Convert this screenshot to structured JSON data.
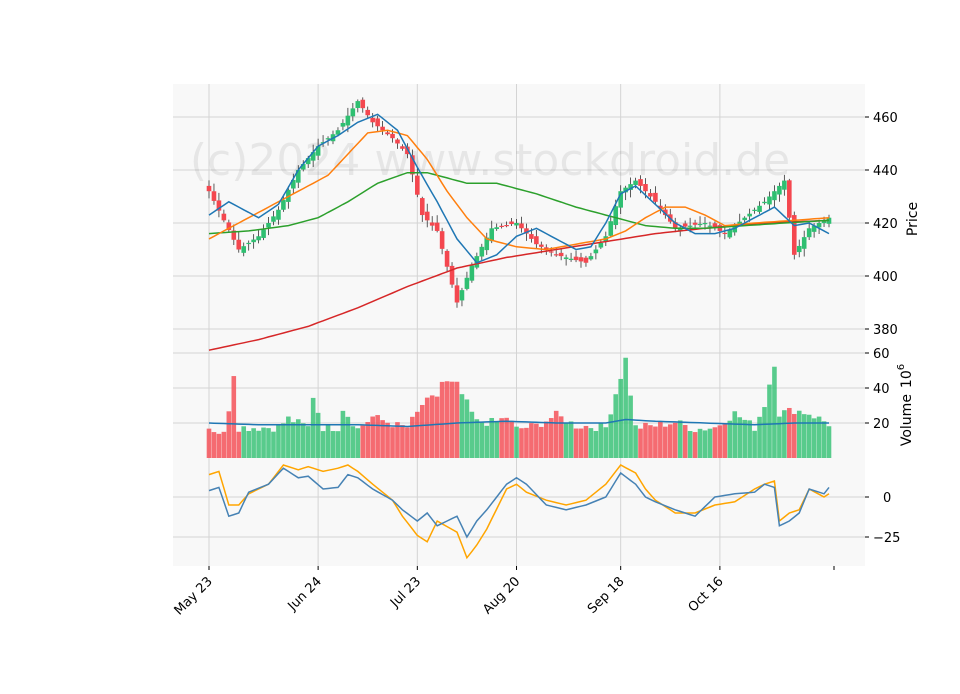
{
  "watermark": "(c)2024 www.stockdroid.de",
  "colors": {
    "up": "#2fbf71",
    "down": "#f4474f",
    "grid": "#d4d4d4",
    "panel": "#f8f8f8",
    "ma_fast": "#1f77b4",
    "ma_mid": "#ff7f0e",
    "ma_slow": "#2ca02c",
    "ma_long": "#d62728",
    "vol_ma": "#1f77b4",
    "osc_a": "#4682b4",
    "osc_b": "#ffa500"
  },
  "chart_data": [
    {
      "type": "candlestick",
      "panel": "price",
      "ylabel": "Price",
      "ylim": [
        375,
        473
      ],
      "yticks": [
        380,
        400,
        420,
        440,
        460
      ],
      "xtick_labels": [
        "May 23",
        "Jun 24",
        "Jul 23",
        "Aug 20",
        "Sep 18",
        "Oct 16"
      ],
      "xtick_index": [
        0,
        22,
        42,
        62,
        83,
        103
      ],
      "grid": true,
      "n_bars": 126,
      "anchors": {
        "close": [
          [
            0,
            432
          ],
          [
            6,
            410
          ],
          [
            10,
            415
          ],
          [
            14,
            425
          ],
          [
            18,
            440
          ],
          [
            22,
            449
          ],
          [
            26,
            455
          ],
          [
            30,
            466
          ],
          [
            33,
            458
          ],
          [
            37,
            452
          ],
          [
            40,
            446
          ],
          [
            43,
            423
          ],
          [
            46,
            417
          ],
          [
            50,
            390
          ],
          [
            53,
            404
          ],
          [
            57,
            418
          ],
          [
            62,
            420
          ],
          [
            66,
            412
          ],
          [
            70,
            408
          ],
          [
            76,
            405
          ],
          [
            80,
            415
          ],
          [
            83,
            432
          ],
          [
            86,
            436
          ],
          [
            90,
            428
          ],
          [
            94,
            418
          ],
          [
            100,
            420
          ],
          [
            104,
            416
          ],
          [
            108,
            422
          ],
          [
            112,
            428
          ],
          [
            116,
            436
          ],
          [
            118,
            408
          ],
          [
            121,
            418
          ],
          [
            125,
            422
          ]
        ],
        "ma_fast": [
          [
            0,
            423
          ],
          [
            4,
            428
          ],
          [
            10,
            422
          ],
          [
            14,
            427
          ],
          [
            18,
            440
          ],
          [
            22,
            449
          ],
          [
            26,
            453
          ],
          [
            30,
            458
          ],
          [
            34,
            461
          ],
          [
            38,
            455
          ],
          [
            42,
            441
          ],
          [
            46,
            428
          ],
          [
            50,
            414
          ],
          [
            54,
            405
          ],
          [
            58,
            408
          ],
          [
            62,
            415
          ],
          [
            66,
            418
          ],
          [
            70,
            414
          ],
          [
            74,
            410
          ],
          [
            77,
            411
          ],
          [
            80,
            420
          ],
          [
            83,
            431
          ],
          [
            86,
            434
          ],
          [
            90,
            427
          ],
          [
            94,
            420
          ],
          [
            98,
            416
          ],
          [
            102,
            416
          ],
          [
            106,
            418
          ],
          [
            110,
            422
          ],
          [
            114,
            426
          ],
          [
            118,
            419
          ],
          [
            121,
            420
          ],
          [
            125,
            416
          ]
        ],
        "ma_mid": [
          [
            0,
            414
          ],
          [
            6,
            420
          ],
          [
            12,
            426
          ],
          [
            18,
            432
          ],
          [
            24,
            438
          ],
          [
            28,
            446
          ],
          [
            32,
            454
          ],
          [
            36,
            455
          ],
          [
            40,
            453
          ],
          [
            44,
            444
          ],
          [
            48,
            432
          ],
          [
            52,
            422
          ],
          [
            56,
            414
          ],
          [
            62,
            411
          ],
          [
            68,
            410
          ],
          [
            74,
            412
          ],
          [
            80,
            414
          ],
          [
            84,
            417
          ],
          [
            88,
            422
          ],
          [
            92,
            426
          ],
          [
            96,
            426
          ],
          [
            100,
            423
          ],
          [
            104,
            419
          ],
          [
            110,
            420
          ],
          [
            118,
            421
          ],
          [
            125,
            422
          ]
        ],
        "ma_slow": [
          [
            0,
            416
          ],
          [
            8,
            417
          ],
          [
            16,
            419
          ],
          [
            22,
            422
          ],
          [
            28,
            428
          ],
          [
            34,
            435
          ],
          [
            40,
            439
          ],
          [
            44,
            439
          ],
          [
            48,
            437
          ],
          [
            52,
            435
          ],
          [
            58,
            435
          ],
          [
            66,
            431
          ],
          [
            74,
            426
          ],
          [
            82,
            422
          ],
          [
            88,
            419
          ],
          [
            94,
            418
          ],
          [
            100,
            418
          ],
          [
            108,
            419
          ],
          [
            116,
            420
          ],
          [
            125,
            421
          ]
        ],
        "ma_long": [
          [
            0,
            372
          ],
          [
            10,
            376
          ],
          [
            20,
            381
          ],
          [
            30,
            388
          ],
          [
            40,
            396
          ],
          [
            50,
            403
          ],
          [
            60,
            407
          ],
          [
            70,
            410
          ],
          [
            80,
            413
          ],
          [
            90,
            416
          ],
          [
            100,
            418
          ],
          [
            112,
            420
          ],
          [
            125,
            421
          ]
        ],
        "volume": [
          [
            0,
            17
          ],
          [
            3,
            13
          ],
          [
            4,
            28
          ],
          [
            5,
            48
          ],
          [
            6,
            17
          ],
          [
            10,
            17
          ],
          [
            14,
            17
          ],
          [
            16,
            22
          ],
          [
            20,
            17
          ],
          [
            21,
            35
          ],
          [
            23,
            17
          ],
          [
            26,
            17
          ],
          [
            27,
            28
          ],
          [
            30,
            16
          ],
          [
            33,
            23
          ],
          [
            38,
            18
          ],
          [
            40,
            17
          ],
          [
            42,
            25
          ],
          [
            43,
            30
          ],
          [
            46,
            35
          ],
          [
            47,
            43
          ],
          [
            50,
            41
          ],
          [
            54,
            20
          ],
          [
            58,
            20
          ],
          [
            60,
            23
          ],
          [
            62,
            16
          ],
          [
            66,
            18
          ],
          [
            70,
            24
          ],
          [
            74,
            18
          ],
          [
            80,
            17
          ],
          [
            84,
            56
          ],
          [
            86,
            17
          ],
          [
            90,
            18
          ],
          [
            94,
            20
          ],
          [
            98,
            16
          ],
          [
            102,
            17
          ],
          [
            106,
            25
          ],
          [
            110,
            17
          ],
          [
            112,
            30
          ],
          [
            114,
            54
          ],
          [
            115,
            25
          ],
          [
            118,
            27
          ],
          [
            121,
            25
          ],
          [
            125,
            19
          ]
        ],
        "vol_ma": [
          [
            0,
            20
          ],
          [
            10,
            19
          ],
          [
            20,
            19
          ],
          [
            30,
            19
          ],
          [
            40,
            18
          ],
          [
            50,
            20
          ],
          [
            60,
            21
          ],
          [
            70,
            20
          ],
          [
            80,
            20
          ],
          [
            84,
            22
          ],
          [
            90,
            21
          ],
          [
            100,
            20
          ],
          [
            110,
            19
          ],
          [
            118,
            20
          ],
          [
            125,
            20
          ]
        ],
        "osc_a": [
          [
            0,
            4
          ],
          [
            2,
            6
          ],
          [
            4,
            -12
          ],
          [
            6,
            -10
          ],
          [
            8,
            3
          ],
          [
            12,
            8
          ],
          [
            15,
            18
          ],
          [
            18,
            12
          ],
          [
            20,
            13
          ],
          [
            23,
            5
          ],
          [
            26,
            6
          ],
          [
            28,
            14
          ],
          [
            30,
            12
          ],
          [
            33,
            5
          ],
          [
            37,
            -2
          ],
          [
            39,
            -8
          ],
          [
            42,
            -15
          ],
          [
            44,
            -10
          ],
          [
            46,
            -18
          ],
          [
            50,
            -12
          ],
          [
            52,
            -25
          ],
          [
            54,
            -15
          ],
          [
            56,
            -8
          ],
          [
            60,
            8
          ],
          [
            62,
            12
          ],
          [
            64,
            8
          ],
          [
            68,
            -5
          ],
          [
            72,
            -8
          ],
          [
            76,
            -5
          ],
          [
            80,
            0
          ],
          [
            83,
            15
          ],
          [
            86,
            8
          ],
          [
            88,
            0
          ],
          [
            90,
            -3
          ],
          [
            94,
            -8
          ],
          [
            98,
            -12
          ],
          [
            102,
            0
          ],
          [
            106,
            2
          ],
          [
            110,
            3
          ],
          [
            112,
            8
          ],
          [
            114,
            6
          ],
          [
            115,
            -18
          ],
          [
            117,
            -15
          ],
          [
            119,
            -10
          ],
          [
            121,
            5
          ],
          [
            124,
            2
          ],
          [
            125,
            6
          ]
        ],
        "osc_b": [
          [
            0,
            14
          ],
          [
            2,
            16
          ],
          [
            4,
            -5
          ],
          [
            6,
            -5
          ],
          [
            8,
            2
          ],
          [
            12,
            8
          ],
          [
            15,
            20
          ],
          [
            18,
            17
          ],
          [
            20,
            19
          ],
          [
            23,
            16
          ],
          [
            26,
            18
          ],
          [
            28,
            20
          ],
          [
            30,
            16
          ],
          [
            33,
            8
          ],
          [
            37,
            -2
          ],
          [
            39,
            -12
          ],
          [
            42,
            -24
          ],
          [
            44,
            -28
          ],
          [
            46,
            -15
          ],
          [
            50,
            -22
          ],
          [
            52,
            -38
          ],
          [
            54,
            -30
          ],
          [
            56,
            -20
          ],
          [
            60,
            5
          ],
          [
            62,
            8
          ],
          [
            64,
            3
          ],
          [
            68,
            -2
          ],
          [
            72,
            -5
          ],
          [
            76,
            -2
          ],
          [
            80,
            8
          ],
          [
            83,
            20
          ],
          [
            86,
            15
          ],
          [
            88,
            5
          ],
          [
            90,
            -2
          ],
          [
            94,
            -10
          ],
          [
            98,
            -10
          ],
          [
            102,
            -5
          ],
          [
            106,
            -3
          ],
          [
            110,
            5
          ],
          [
            112,
            8
          ],
          [
            114,
            10
          ],
          [
            115,
            -15
          ],
          [
            117,
            -10
          ],
          [
            119,
            -8
          ],
          [
            121,
            5
          ],
          [
            124,
            0
          ],
          [
            125,
            2
          ]
        ]
      }
    },
    {
      "type": "bar",
      "panel": "volume",
      "ylabel": "Volume",
      "ylabel_exp": "10",
      "ylabel_sup": "6",
      "ylim": [
        0,
        60
      ],
      "yticks": [
        20,
        40,
        60
      ],
      "grid": true
    },
    {
      "type": "line",
      "panel": "oscillator",
      "ylim": [
        -38,
        20
      ],
      "yticks": [
        -25,
        0
      ],
      "grid": true
    }
  ]
}
